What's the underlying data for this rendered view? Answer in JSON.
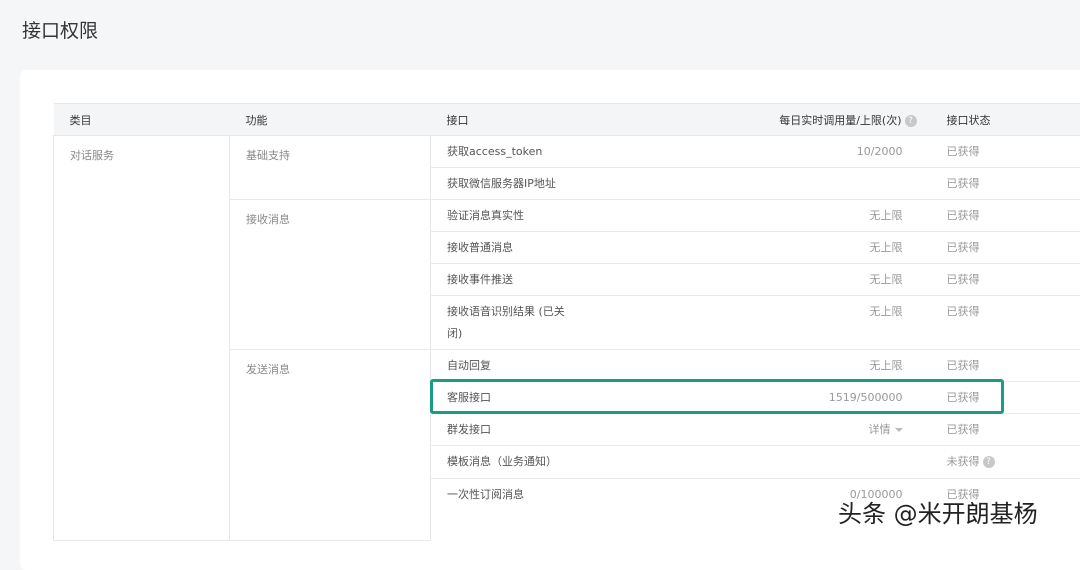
{
  "page_title": "接口权限",
  "headers": {
    "category": "类目",
    "function": "功能",
    "api": "接口",
    "usage": "每日实时调用量/上限(次)",
    "status": "接口状态"
  },
  "category": "对话服务",
  "functions": [
    "基础支持",
    "接收消息",
    "发送消息"
  ],
  "rows": [
    {
      "api": "获取access_token",
      "usage": "10/2000",
      "status": "已获得"
    },
    {
      "api": "获取微信服务器IP地址",
      "usage": "",
      "status": "已获得"
    },
    {
      "api": "验证消息真实性",
      "usage": "无上限",
      "status": "已获得"
    },
    {
      "api": "接收普通消息",
      "usage": "无上限",
      "status": "已获得"
    },
    {
      "api": "接收事件推送",
      "usage": "无上限",
      "status": "已获得"
    },
    {
      "api": "接收语音识别结果 (已关闭)",
      "usage": "无上限",
      "status": "已获得"
    },
    {
      "api": "自动回复",
      "usage": "无上限",
      "status": "已获得"
    },
    {
      "api": "客服接口",
      "usage": "1519/500000",
      "status": "已获得"
    },
    {
      "api": "群发接口",
      "usage": "详情",
      "status": "已获得"
    },
    {
      "api": "模板消息（业务通知）",
      "usage": "",
      "status": "未获得"
    },
    {
      "api": "一次性订阅消息",
      "usage": "0/100000",
      "status": "已获得"
    }
  ],
  "watermark": "头条 @米开朗基杨",
  "colors": {
    "highlight": "#1a9b85"
  }
}
